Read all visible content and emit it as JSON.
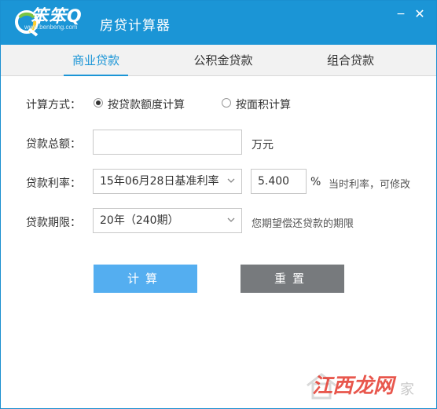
{
  "app": {
    "logo_text": "笨笨Q",
    "logo_sub": "www.benbeng.com",
    "title": "房贷计算器",
    "minimize": "−",
    "close": "✕"
  },
  "tabs": [
    {
      "label": "商业贷款",
      "active": true
    },
    {
      "label": "公积金贷款",
      "active": false
    },
    {
      "label": "组合贷款",
      "active": false
    }
  ],
  "form": {
    "mode_label": "计算方式：",
    "mode_options": [
      {
        "label": "按贷款额度计算",
        "checked": true
      },
      {
        "label": "按面积计算",
        "checked": false
      }
    ],
    "amount_label": "贷款总额：",
    "amount_value": "",
    "amount_unit": "万元",
    "rate_label": "贷款利率：",
    "rate_select": "15年06月28日基准利率",
    "rate_value": "5.400",
    "rate_unit": "%",
    "rate_note": "当时利率，可修改",
    "term_label": "贷款期限：",
    "term_select": "20年（240期）",
    "term_note": "您期望偿还贷款的期限"
  },
  "buttons": {
    "calculate": "计算",
    "reset": "重置"
  },
  "watermark": {
    "text": "江西龙网",
    "faint": "家"
  },
  "colors": {
    "titlebar": "#1b95d6",
    "calc_button": "#54aef0",
    "reset_button": "#777a7d",
    "watermark": "#e53a2f"
  }
}
